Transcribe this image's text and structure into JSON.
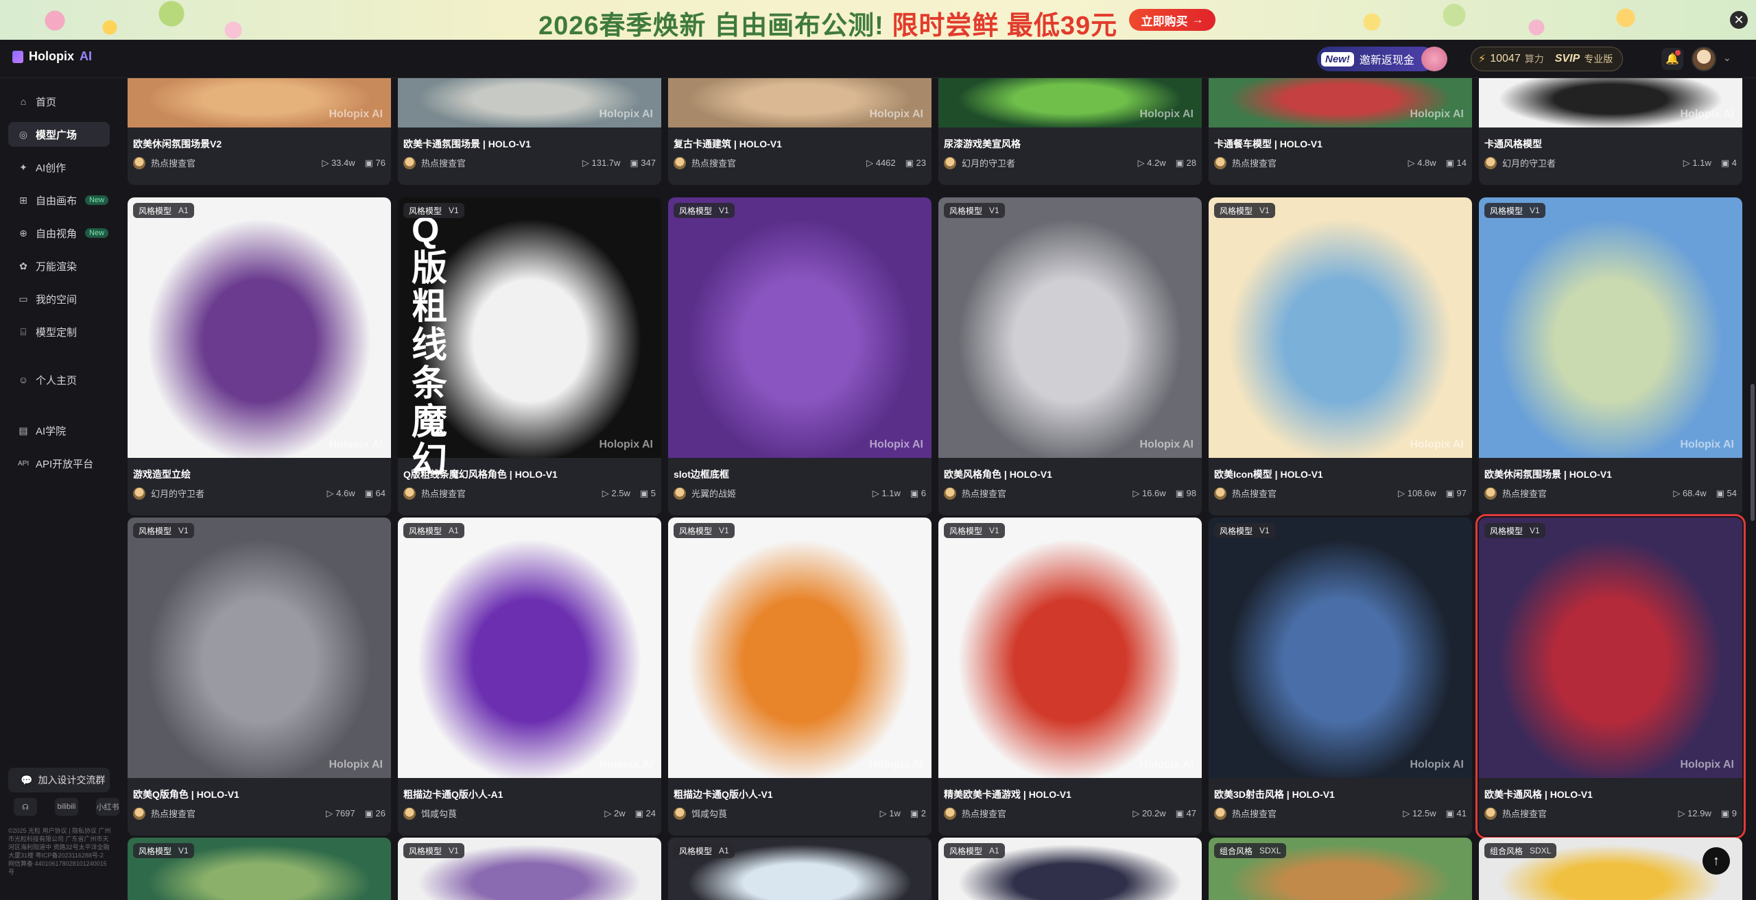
{
  "banner": {
    "text_green": "2026春季焕新 自由画布公测!",
    "text_red": "限时尝鲜 最低39元",
    "cta": "立即购买",
    "close": "✕"
  },
  "header": {
    "logo_text": "Holopix",
    "logo_ai": "AI",
    "invite_new": "New!",
    "invite_label": "邀新返现金",
    "points_value": "10047",
    "points_unit": "算力",
    "svip": "SVIP",
    "pro": "专业版"
  },
  "sidebar": {
    "items": [
      {
        "label": "首页",
        "icon": "home-icon"
      },
      {
        "label": "模型广场",
        "icon": "compass-icon"
      },
      {
        "label": "AI创作",
        "icon": "sparkle-icon"
      },
      {
        "label": "自由画布",
        "icon": "canvas-icon",
        "tag": "New"
      },
      {
        "label": "自由视角",
        "icon": "view-icon",
        "tag": "New"
      },
      {
        "label": "万能渲染",
        "icon": "render-icon"
      },
      {
        "label": "我的空间",
        "icon": "folder-icon"
      },
      {
        "label": "模型定制",
        "icon": "lock-icon"
      },
      {
        "label": "个人主页",
        "icon": "user-icon"
      },
      {
        "label": "AI学院",
        "icon": "book-icon"
      },
      {
        "label": "API开放平台",
        "icon": "api-icon"
      }
    ],
    "join_label": "加入设计交流群",
    "mini": [
      "☊",
      "bilibili",
      "小红书"
    ],
    "footer": "©2025 光粒 用户协议 | 隐私协议 广州市光粒科技有限公司 广东省广州市天河区海利阳道中 资路32号太平洋全融大厦31楼 粤ICP备2023116288号-2 网信算备 440106178028101240015号"
  },
  "cards": [
    {
      "title": "欧美休闲氛围场景V2",
      "author": "热点搜查官",
      "views": "33.4w",
      "imgs": "76"
    },
    {
      "title": "欧美卡通氛围场景 | HOLO-V1",
      "author": "热点搜查官",
      "views": "131.7w",
      "imgs": "347"
    },
    {
      "title": "复古卡通建筑 | HOLO-V1",
      "author": "热点搜查官",
      "views": "4462",
      "imgs": "23"
    },
    {
      "title": "尿漆游戏美宣风格",
      "author": "幻月的守卫者",
      "views": "4.2w",
      "imgs": "28"
    },
    {
      "title": "卡通餐车模型 | HOLO-V1",
      "author": "热点搜查官",
      "views": "4.8w",
      "imgs": "14"
    },
    {
      "title": "卡通风格模型",
      "author": "幻月的守卫者",
      "views": "1.1w",
      "imgs": "4"
    },
    {
      "tag": "风格模型",
      "ver": "A1",
      "title": "游戏造型立绘",
      "author": "幻月的守卫者",
      "views": "4.6w",
      "imgs": "64"
    },
    {
      "tag": "风格模型",
      "ver": "V1",
      "title": "Q版粗线条魔幻风格角色 | HOLO-V1",
      "author": "热点搜查官",
      "views": "2.5w",
      "imgs": "5",
      "vtext": "Q版粗线条魔幻"
    },
    {
      "tag": "风格模型",
      "ver": "V1",
      "title": "slot边框底框",
      "author": "光翼的战姬",
      "views": "1.1w",
      "imgs": "6"
    },
    {
      "tag": "风格模型",
      "ver": "V1",
      "title": "欧美风格角色 | HOLO-V1",
      "author": "热点搜查官",
      "views": "16.6w",
      "imgs": "98"
    },
    {
      "tag": "风格模型",
      "ver": "V1",
      "title": "欧美Icon模型 | HOLO-V1",
      "author": "热点搜查官",
      "views": "108.6w",
      "imgs": "97"
    },
    {
      "tag": "风格模型",
      "ver": "V1",
      "title": "欧美休闲氛围场景 | HOLO-V1",
      "author": "热点搜查官",
      "views": "68.4w",
      "imgs": "54"
    },
    {
      "tag": "风格模型",
      "ver": "V1",
      "title": "欧美Q版角色 | HOLO-V1",
      "author": "热点搜查官",
      "views": "7697",
      "imgs": "26"
    },
    {
      "tag": "风格模型",
      "ver": "A1",
      "title": "粗描边卡通Q版小人-A1",
      "author": "饵咸勾茛",
      "views": "2w",
      "imgs": "24"
    },
    {
      "tag": "风格模型",
      "ver": "V1",
      "title": "粗描边卡通Q版小人-V1",
      "author": "饵咸勾茛",
      "views": "1w",
      "imgs": "2"
    },
    {
      "tag": "风格模型",
      "ver": "V1",
      "title": "精美欧美卡通游戏 | HOLO-V1",
      "author": "热点搜查官",
      "views": "20.2w",
      "imgs": "47"
    },
    {
      "tag": "风格模型",
      "ver": "V1",
      "title": "欧美3D射击风格 | HOLO-V1",
      "author": "热点搜查官",
      "views": "12.5w",
      "imgs": "41"
    },
    {
      "tag": "风格模型",
      "ver": "V1",
      "title": "欧美卡通风格 | HOLO-V1",
      "author": "热点搜查官",
      "views": "12.9w",
      "imgs": "9"
    },
    {
      "tag": "风格模型",
      "ver": "V1"
    },
    {
      "tag": "风格模型",
      "ver": "V1"
    },
    {
      "tag": "风格模型",
      "ver": "A1"
    },
    {
      "tag": "风格模型",
      "ver": "A1"
    },
    {
      "tag": "组合风格",
      "ver": "SDXL"
    },
    {
      "tag": "组合风格",
      "ver": "SDXL"
    }
  ],
  "watermark": "Holopix AI",
  "colors": {
    "accent": "#e23a3a",
    "banner_green": "#3f7a3c",
    "banner_red": "#e23b2c",
    "bg": "#17171b"
  }
}
